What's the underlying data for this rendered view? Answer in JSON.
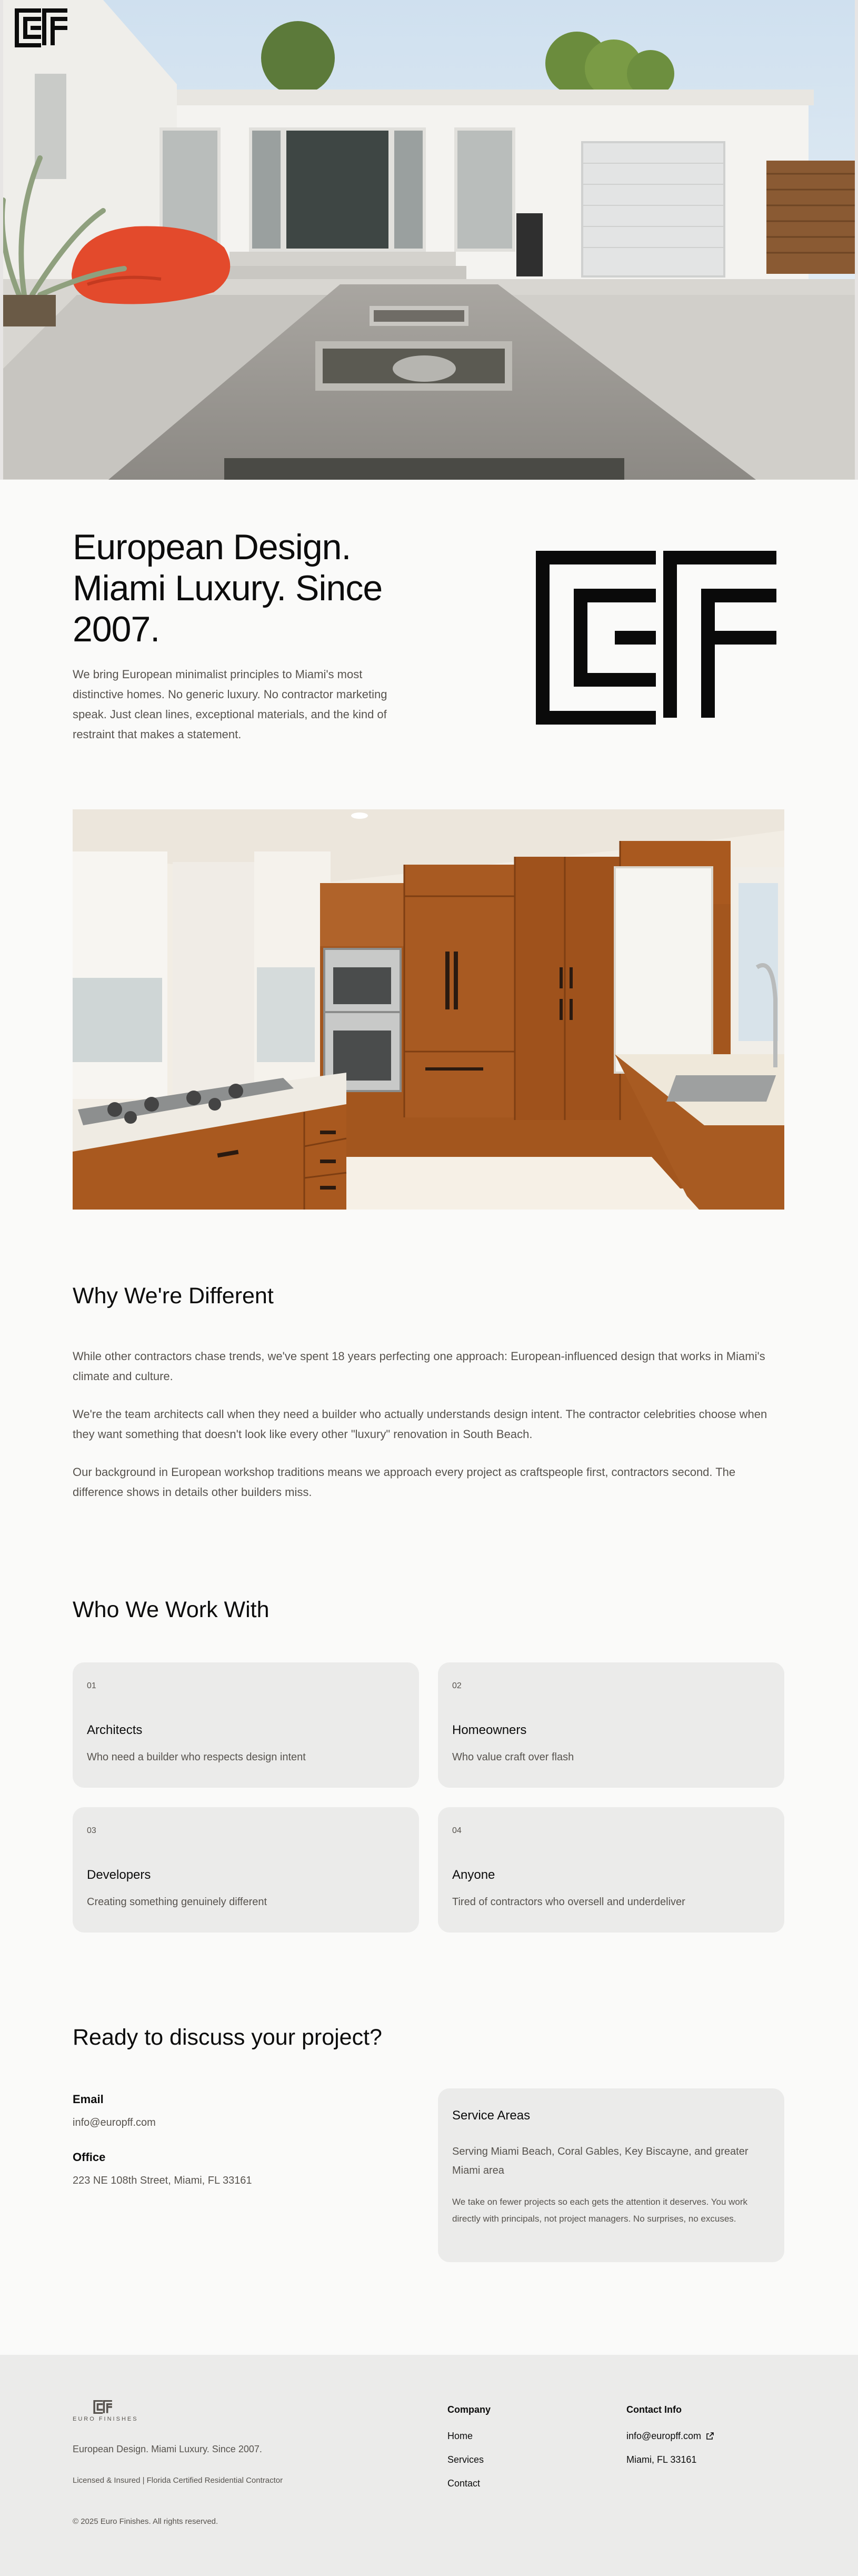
{
  "brand": {
    "logo_text": "EURO FINISHES"
  },
  "intro": {
    "headline_lines": [
      "European Design.",
      "Miami Luxury. Since",
      "2007."
    ],
    "body": "We bring European minimalist principles to Miami's most distinctive homes. No generic luxury. No contractor marketing speak. Just clean lines, exceptional materials, and the kind of restraint that makes a statement."
  },
  "why": {
    "title": "Why We're Different",
    "paragraphs": [
      "While other contractors chase trends, we've spent 18 years perfecting one approach: European-influenced design that works in Miami's climate and culture.",
      "We're the team architects call when they need a builder who actually understands design intent. The contractor celebrities choose when they want something that doesn't look like every other \"luxury\" renovation in South Beach.",
      "Our background in European workshop traditions means we approach every project as craftspeople first, contractors second. The difference shows in details other builders miss."
    ]
  },
  "who": {
    "title": "Who We Work With",
    "cards": [
      {
        "num": "01",
        "title": "Architects",
        "desc": "Who need a builder who respects design intent"
      },
      {
        "num": "02",
        "title": "Homeowners",
        "desc": "Who value craft over flash"
      },
      {
        "num": "03",
        "title": "Developers",
        "desc": "Creating something genuinely different"
      },
      {
        "num": "04",
        "title": "Anyone",
        "desc": "Tired of contractors who oversell and underdeliver"
      }
    ]
  },
  "contact": {
    "title": "Ready to discuss your project?",
    "email_label": "Email",
    "email": "info@europff.com",
    "office_label": "Office",
    "office": "223 NE 108th Street, Miami, FL 33161",
    "areas_title": "Service Areas",
    "areas_body": "Serving Miami Beach, Coral Gables, Key Biscayne, and greater Miami area",
    "areas_note": "We take on fewer projects so each gets the attention it deserves. You work directly with principals, not project managers. No surprises, no excuses."
  },
  "footer": {
    "tagline": "European Design. Miami Luxury. Since 2007.",
    "license": "Licensed & Insured | Florida Certified Residential Contractor",
    "copyright": "© 2025 Euro Finishes. All rights reserved.",
    "company_heading": "Company",
    "company_links": [
      "Home",
      "Services",
      "Contact"
    ],
    "contact_heading": "Contact Info",
    "contact_email": "info@europff.com",
    "contact_city": "Miami, FL 33161"
  }
}
